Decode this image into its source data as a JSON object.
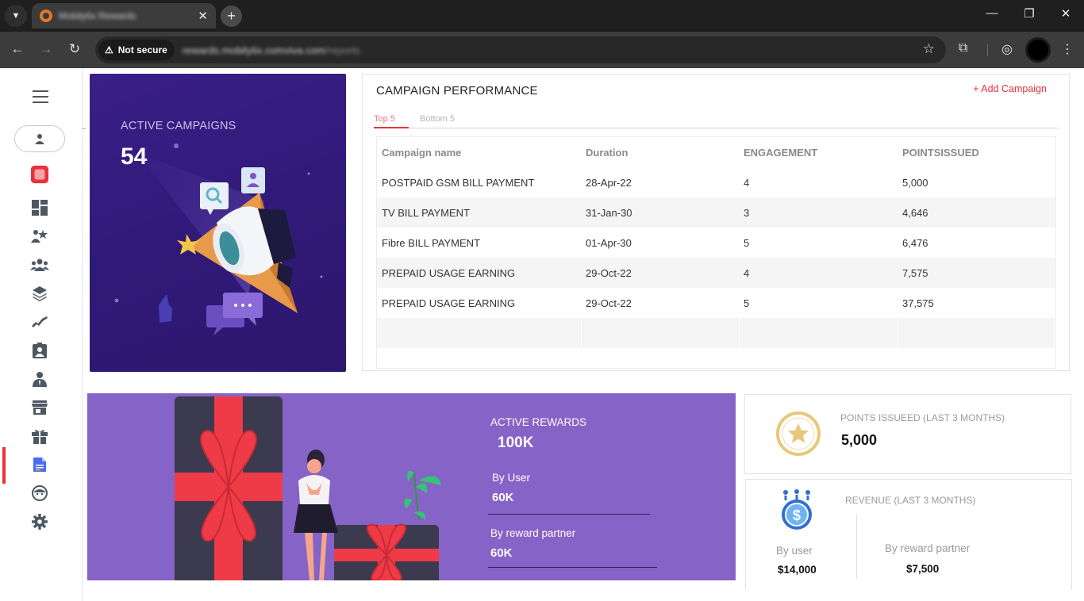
{
  "browser": {
    "tab_title": "Mobilytix Rewards",
    "security_label": "Not secure",
    "url_host": "rewards.mobilytix.comviva.com",
    "url_path": "/reports"
  },
  "sidebar": {
    "active_item": "reports"
  },
  "hero": {
    "label": "ACTIVE CAMPAIGNS",
    "value": "54"
  },
  "campaign_performance": {
    "title": "CAMPAIGN PERFORMANCE",
    "add_label": "+ Add Campaign",
    "tabs": [
      "Top 5",
      "Bottom 5"
    ],
    "columns": [
      "Campaign name",
      "Duration",
      "ENGAGEMENT",
      "POINTSISSUED"
    ],
    "rows": [
      [
        "POSTPAID GSM BILL PAYMENT",
        "28-Apr-22",
        "4",
        "5,000"
      ],
      [
        "TV BILL PAYMENT",
        "31-Jan-30",
        "3",
        "4,646"
      ],
      [
        "Fibre BILL PAYMENT",
        "01-Apr-30",
        "5",
        "6,476"
      ],
      [
        "PREPAID USAGE EARNING",
        "29-Oct-22",
        "4",
        "7,575"
      ],
      [
        "PREPAID USAGE EARNING",
        "29-Oct-22",
        "5",
        "37,575"
      ]
    ]
  },
  "rewards": {
    "label": "ACTIVE REWARDS",
    "value": "100K",
    "by_user_label": "By User",
    "by_user_value": "60K",
    "by_partner_label": "By reward partner",
    "by_partner_value": "60K"
  },
  "points_card": {
    "label": "POINTS ISSUEED (LAST 3 MONTHS)",
    "value": "5,000"
  },
  "revenue_card": {
    "label": "REVENUE (LAST 3 MONTHS)",
    "by_user_label": "By user",
    "by_user_value": "$14,000",
    "by_partner_label": "By reward partner",
    "by_partner_value": "$7,500"
  },
  "colors": {
    "accent": "#e8323c",
    "hero_bg": "#331b7c",
    "rewards_bg": "#8663c6",
    "gift_ribbon": "#ef3b47",
    "coin_gold": "#e8c77a"
  }
}
